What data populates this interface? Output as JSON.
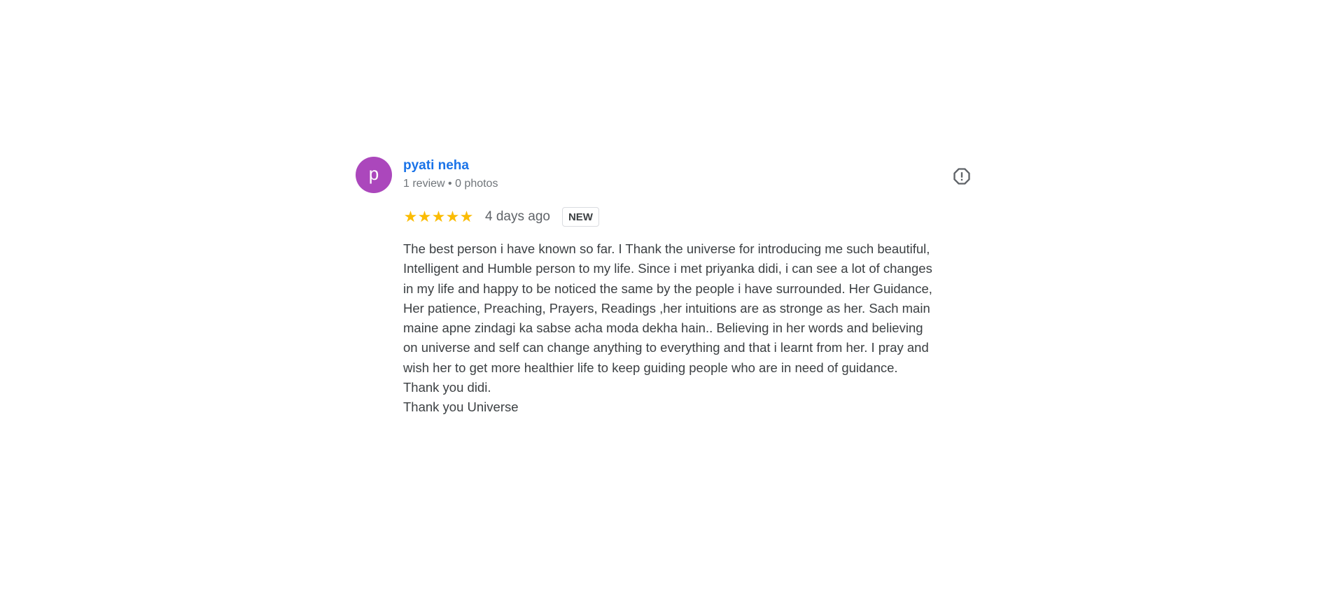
{
  "review": {
    "avatar_letter": "p",
    "avatar_color": "#ab47bc",
    "reviewer_name": "pyati neha",
    "reviewer_meta": "1 review • 0 photos",
    "report_icon": "report-flag-icon",
    "rating": 5,
    "max_rating": 5,
    "star_color": "#fbbc04",
    "star_empty_color": "#dadce0",
    "date": "4 days ago",
    "badge": "NEW",
    "text_lines": [
      "The best person i have known so far. I Thank the universe for introducing me such beautiful,",
      "Intelligent and Humble person to my life. Since i met priyanka didi, i can see a lot of changes",
      "in my life and happy to be noticed the same by the people i have surrounded. Her Guidance,",
      "Her patience, Preaching, Prayers, Readings ,her intuitions are as stronge as her. Sach main",
      "maine apne zindagi ka sabse acha moda dekha hain.. Believing in her words and believing",
      "on universe and self can change anything to everything and that i learnt from her. I pray and",
      "wish her to get more healthier life to keep guiding people who are in need of guidance.",
      "Thank you didi.",
      "Thank you Universe"
    ]
  }
}
